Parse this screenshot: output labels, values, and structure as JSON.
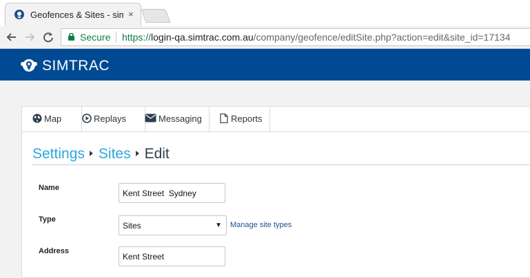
{
  "browser": {
    "tab_title": "Geofences & Sites - simTRAC",
    "tab_close": "×",
    "secure_label": "Secure",
    "url_scheme": "https://",
    "url_host": "login-qa.simtrac.com.au",
    "url_path": "/company/geofence/editSite.php?action=edit&site_id=17134"
  },
  "app": {
    "brand": "SIMTRAC"
  },
  "nav": {
    "tabs": [
      {
        "label": "Map"
      },
      {
        "label": "Replays"
      },
      {
        "label": "Messaging"
      },
      {
        "label": "Reports"
      }
    ]
  },
  "breadcrumb": {
    "settings": "Settings",
    "sites": "Sites",
    "current": "Edit"
  },
  "form": {
    "name_label": "Name",
    "name_value": "Kent Street  Sydney",
    "type_label": "Type",
    "type_value": "Sites",
    "type_caret": "▼",
    "manage_link": "Manage site types",
    "address_label": "Address",
    "address_value": "Kent Street"
  },
  "colors": {
    "header": "#004a93",
    "breadcrumb_link": "#2aa6dd",
    "secure": "#0b8043"
  },
  "icons": [
    "simtrac-favicon",
    "back-arrow-icon",
    "forward-arrow-icon",
    "reload-icon",
    "lock-icon",
    "globe-icon",
    "play-circle-icon",
    "envelope-icon",
    "document-icon"
  ]
}
